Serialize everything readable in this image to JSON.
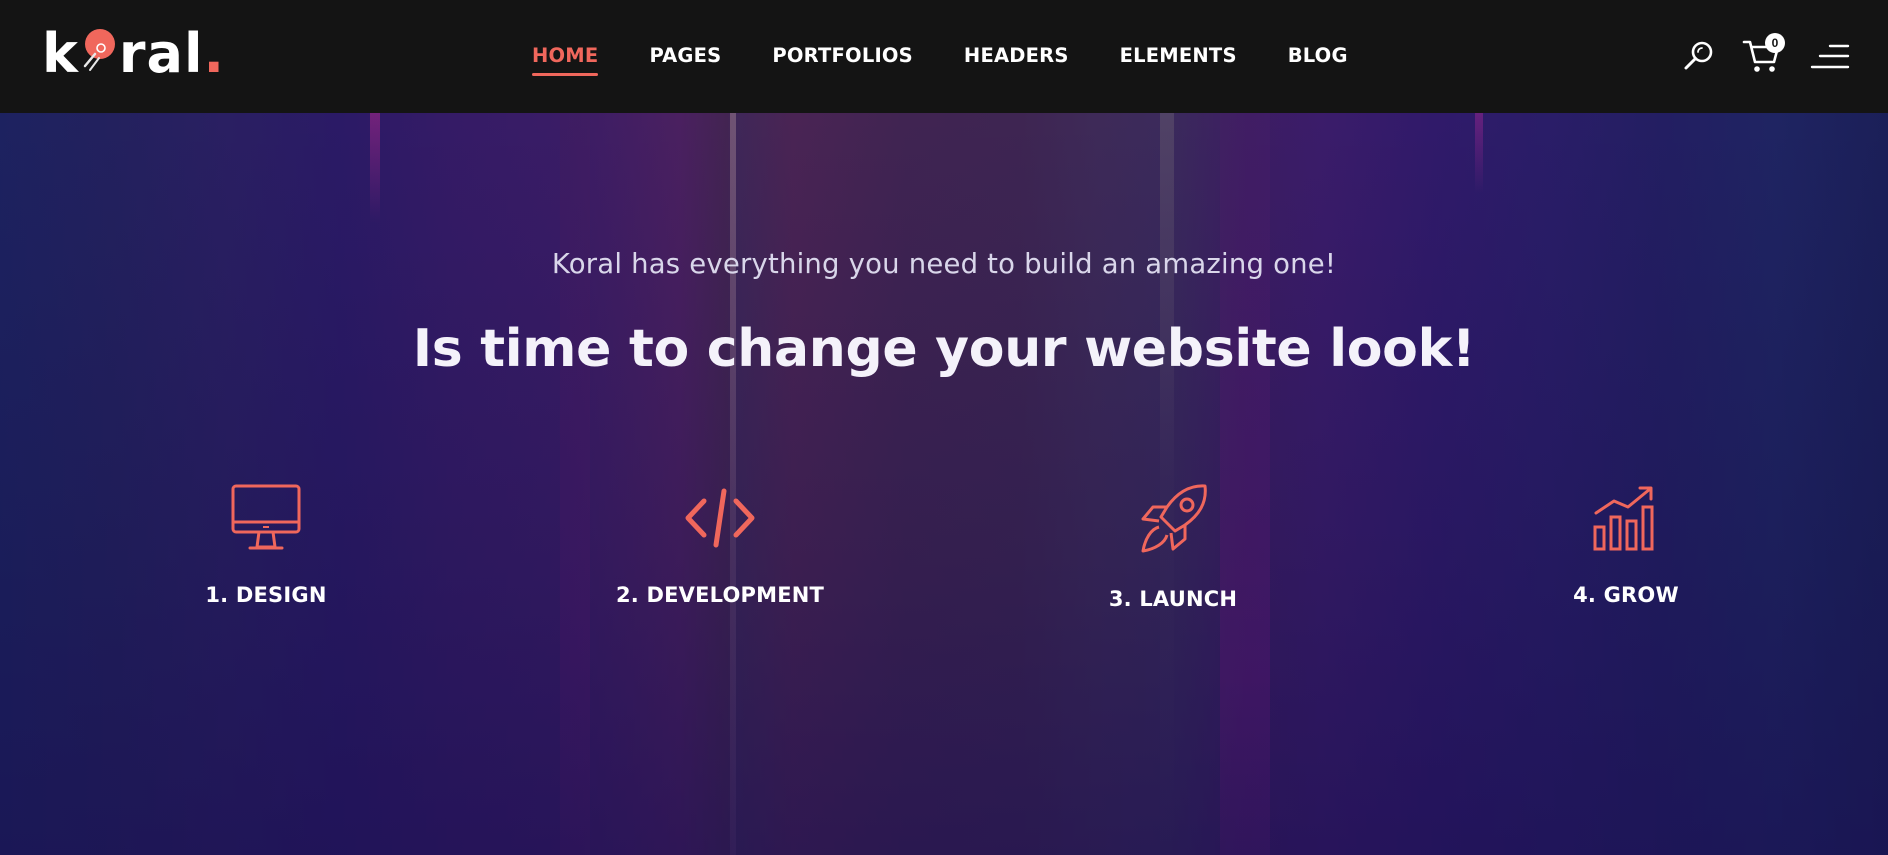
{
  "brand": {
    "name_part1": "k",
    "name_part2": "ral",
    "dot": ".",
    "accent": "#f0675c"
  },
  "nav": {
    "items": [
      {
        "label": "HOME",
        "active": true
      },
      {
        "label": "PAGES",
        "active": false
      },
      {
        "label": "PORTFOLIOS",
        "active": false
      },
      {
        "label": "HEADERS",
        "active": false
      },
      {
        "label": "ELEMENTS",
        "active": false
      },
      {
        "label": "BLOG",
        "active": false
      }
    ]
  },
  "header_icons": {
    "search": "search-icon",
    "cart": "cart-icon",
    "cart_count": "0",
    "menu": "menu-icon"
  },
  "hero": {
    "subtitle": "Koral has everything you need to build an amazing one!",
    "title": "Is time to change your website look!",
    "steps": [
      {
        "label": "1. DESIGN",
        "icon": "monitor-icon"
      },
      {
        "label": "2. DEVELOPMENT",
        "icon": "code-icon"
      },
      {
        "label": "3. LAUNCH",
        "icon": "rocket-icon"
      },
      {
        "label": "4. GROW",
        "icon": "growth-chart-icon"
      }
    ]
  },
  "colors": {
    "header_bg": "#141414",
    "hero_bg_start": "#1d2260",
    "hero_bg_mid": "#402452",
    "text": "#ffffff"
  }
}
